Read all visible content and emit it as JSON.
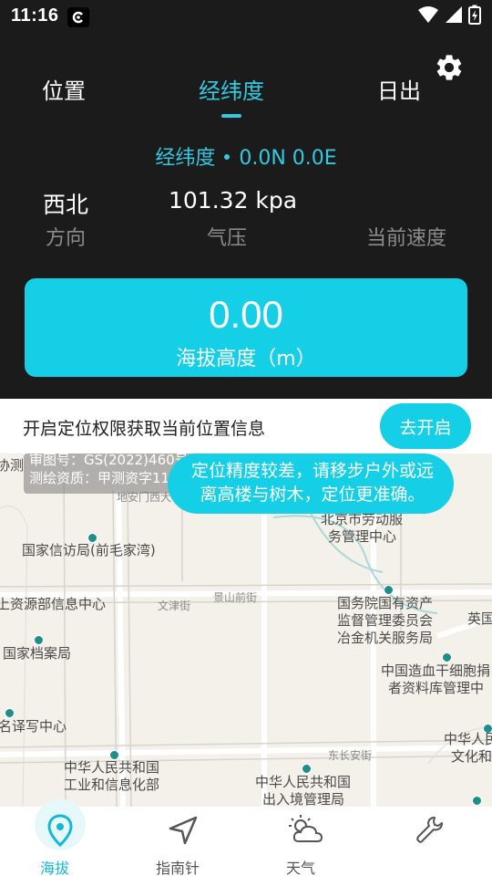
{
  "status_bar": {
    "time": "11:16"
  },
  "tabs": [
    {
      "label": "位置"
    },
    {
      "label": "经纬度"
    },
    {
      "label": "日出"
    }
  ],
  "coordinates": {
    "label": "经纬度",
    "value": "0.0N 0.0E"
  },
  "stats": [
    {
      "value": "西北",
      "label": "方向"
    },
    {
      "value": "101.32 kpa",
      "label": "气压"
    },
    {
      "value": "",
      "label": "当前速度"
    }
  ],
  "altitude": {
    "value": "0.00",
    "label": "海拔高度（m）"
  },
  "permission_banner": {
    "text": "开启定位权限获取当前位置信息",
    "button": "去开启"
  },
  "map": {
    "copyright_line1": "审图号：GS(2022)460号",
    "copyright_line2": "测绘资质：甲测资字11111342",
    "toast": "定位精度较差，请移步户外或远离高楼与树木，定位更准确。",
    "labels": {
      "l1": "北京市劳动服",
      "l1b": "务管理中心",
      "l2": "国家信访局(前毛家湾)",
      "l3": "上资源部信息中心",
      "l4": "国务院国有资产",
      "l4b": "监督管理委员会",
      "l4c": "冶金机关服务局",
      "l5": "英国",
      "l6": "国家档案局",
      "l7": "中国造血干细胞捐",
      "l7b": "者资料库管理中",
      "l8": "名译写中心",
      "l9": "中华人民共和国",
      "l9b": "工业和信息化部",
      "l10": "中华人民共和国",
      "l10b": "出入境管理局",
      "l11": "中华人民",
      "l11b": "文化和",
      "l12": "协测",
      "road1": "地安门西大",
      "road2": "文津街",
      "road3": "景山前街",
      "road4": "东长安街"
    }
  },
  "bottom_nav": [
    {
      "label": "海拔"
    },
    {
      "label": "指南针"
    },
    {
      "label": "天气"
    },
    {
      "label": ""
    }
  ],
  "colors": {
    "accent": "#14cfe6",
    "background": "#1b1b1b"
  }
}
